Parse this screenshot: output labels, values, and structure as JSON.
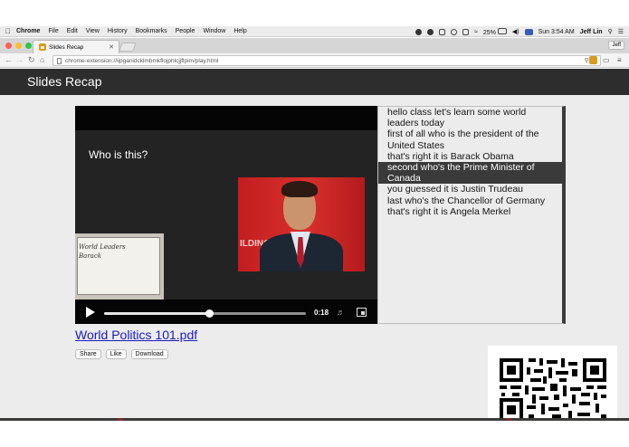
{
  "menubar": {
    "items": [
      "Chrome",
      "File",
      "Edit",
      "View",
      "History",
      "Bookmarks",
      "People",
      "Window",
      "Help"
    ],
    "battery": "25%",
    "clock": "Sun 3:54 AM",
    "user": "Jeff Lin"
  },
  "browser": {
    "tab_title": "Slides Recap",
    "profile_name": "Jeff",
    "url": "chrome-extension://iipganidcklmbmkflojphlcjjflpim/play.html",
    "traffic_light_colors": [
      "#ff5f57",
      "#febc2e",
      "#28c840"
    ]
  },
  "app": {
    "title": "Slides Recap"
  },
  "video": {
    "slide_text": "Who is this?",
    "photo_sign": "ILDING",
    "whiteboard_lines": [
      "World Leaders",
      "Barack"
    ],
    "time": "0:18",
    "progress": 0.52
  },
  "transcript": {
    "lines": [
      "hello class let's learn some world",
      "leaders today",
      "first of all who is the president of the",
      "United States",
      "that's right it is Barack Obama",
      "second who's the Prime Minister of",
      "Canada",
      "you guessed it is Justin Trudeau",
      "last who's the Chancellor of Germany",
      "that's right it is Angela Merkel"
    ],
    "active_indices": [
      5,
      6
    ]
  },
  "document": {
    "link_text": "World Politics 101.pdf",
    "share_label": "Share",
    "like_label": "Like",
    "download_label": "Download"
  }
}
